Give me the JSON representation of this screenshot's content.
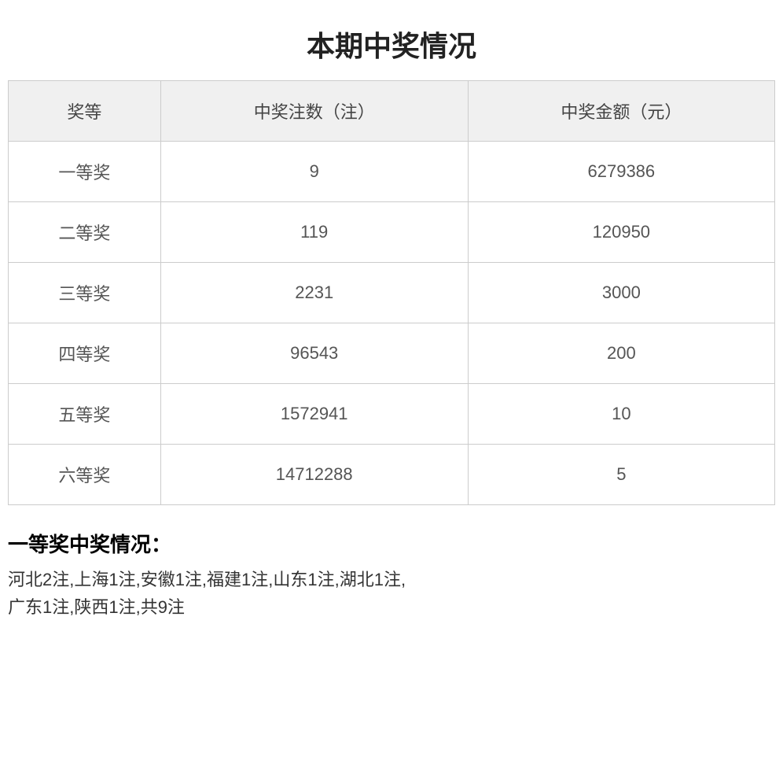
{
  "page": {
    "title": "本期中奖情况"
  },
  "table": {
    "headers": [
      "奖等",
      "中奖注数（注）",
      "中奖金额（元）"
    ],
    "rows": [
      {
        "level": "一等奖",
        "count": "9",
        "amount": "6279386"
      },
      {
        "level": "二等奖",
        "count": "119",
        "amount": "120950"
      },
      {
        "level": "三等奖",
        "count": "2231",
        "amount": "3000"
      },
      {
        "level": "四等奖",
        "count": "96543",
        "amount": "200"
      },
      {
        "level": "五等奖",
        "count": "1572941",
        "amount": "10"
      },
      {
        "level": "六等奖",
        "count": "14712288",
        "amount": "5"
      }
    ]
  },
  "bottom": {
    "title": "一等奖中奖情况：",
    "text": "河北2注,上海1注,安徽1注,福建1注,山东1注,湖北1注,\n广东1注,陕西1注,共9注"
  }
}
